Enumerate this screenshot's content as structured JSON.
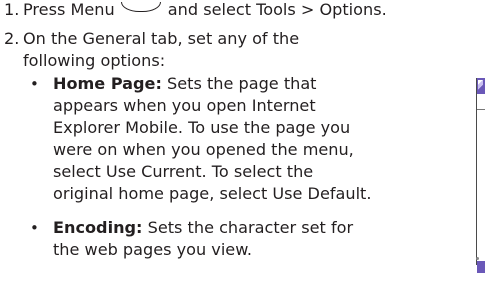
{
  "steps": [
    {
      "number": "1.",
      "before": "Press Menu",
      "menu_icon": "menu-softkey-icon",
      "after": "and select Tools > Options."
    },
    {
      "number": "2.",
      "line1": "On the General tab, set any of the",
      "line2": "following options:"
    }
  ],
  "options": [
    {
      "term": "Home Page:",
      "lines": [
        "Sets the page that",
        "appears when you open Internet",
        "Explorer Mobile. To use the page you",
        "were on when you opened the menu,",
        "select Use Current. To select the",
        "original home page, select Use Default."
      ]
    },
    {
      "term": "Encoding:",
      "lines": [
        "Sets the character set for",
        "the web pages you view."
      ]
    }
  ],
  "bullet_char": "•",
  "colors": {
    "text": "#231f20",
    "screen_accent": "#6a58b8"
  }
}
